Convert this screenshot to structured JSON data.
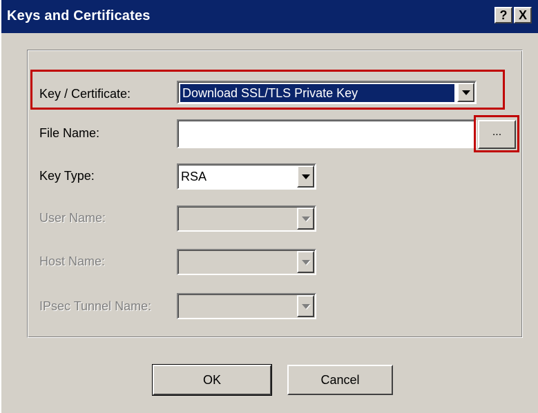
{
  "window": {
    "title": "Keys and Certificates",
    "help_label": "?",
    "close_label": "X"
  },
  "form": {
    "key_certificate": {
      "label": "Key / Certificate:",
      "value": "Download SSL/TLS Private Key"
    },
    "file_name": {
      "label": "File Name:",
      "value": "",
      "browse_label": "..."
    },
    "key_type": {
      "label": "Key Type:",
      "value": "RSA"
    },
    "user_name": {
      "label": "User Name:",
      "value": ""
    },
    "host_name": {
      "label": "Host Name:",
      "value": ""
    },
    "ipsec_tunnel_name": {
      "label": "IPsec Tunnel Name:",
      "value": ""
    }
  },
  "buttons": {
    "ok": "OK",
    "cancel": "Cancel"
  },
  "colors": {
    "titlebar": "#0a246a",
    "face": "#d4d0c8",
    "selection": "#0a246a",
    "highlight_box": "#c00000"
  }
}
